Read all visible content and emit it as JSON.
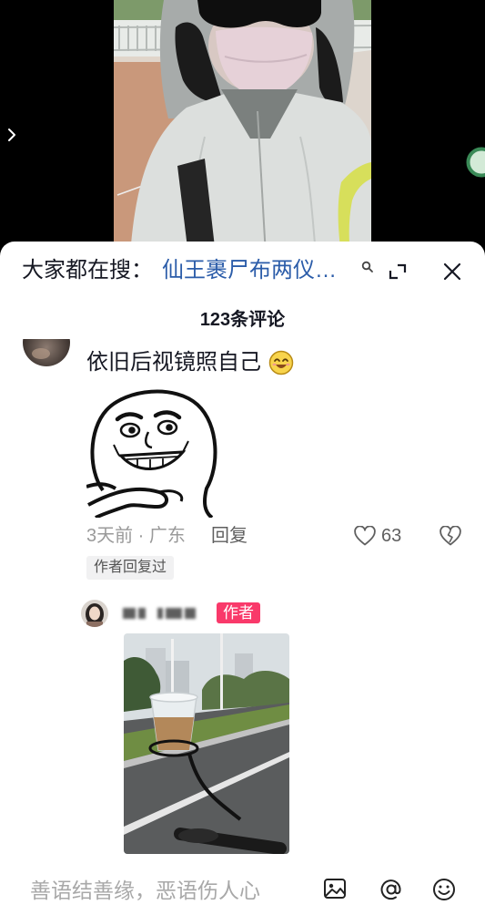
{
  "search_row": {
    "prefix": "大家都在搜：",
    "query": "仙王裹尸布两仪…",
    "query_color": "#2b5ca9"
  },
  "header": {
    "comment_count": "123条评论"
  },
  "comment": {
    "text": "依旧后视镜照自己",
    "time_location": "3天前 · 广东",
    "reply_label": "回复",
    "like_count": "63",
    "author_replied_badge": "作者回复过"
  },
  "reply": {
    "author_badge": "作者",
    "author_badge_color": "#f9396a"
  },
  "input_bar": {
    "placeholder": "善语结善缘，恶语伤人心"
  },
  "icons": {
    "prev": "chevron-right-icon",
    "side_button": "green-ring-icon",
    "search": "search-icon",
    "collapse": "collapse-icon",
    "close": "close-icon",
    "comment_emoji": "smile-emoji-icon",
    "like": "heart-outline-icon",
    "dislike": "broken-heart-icon",
    "image": "image-icon",
    "mention": "at-icon",
    "emoji": "emoji-icon"
  }
}
